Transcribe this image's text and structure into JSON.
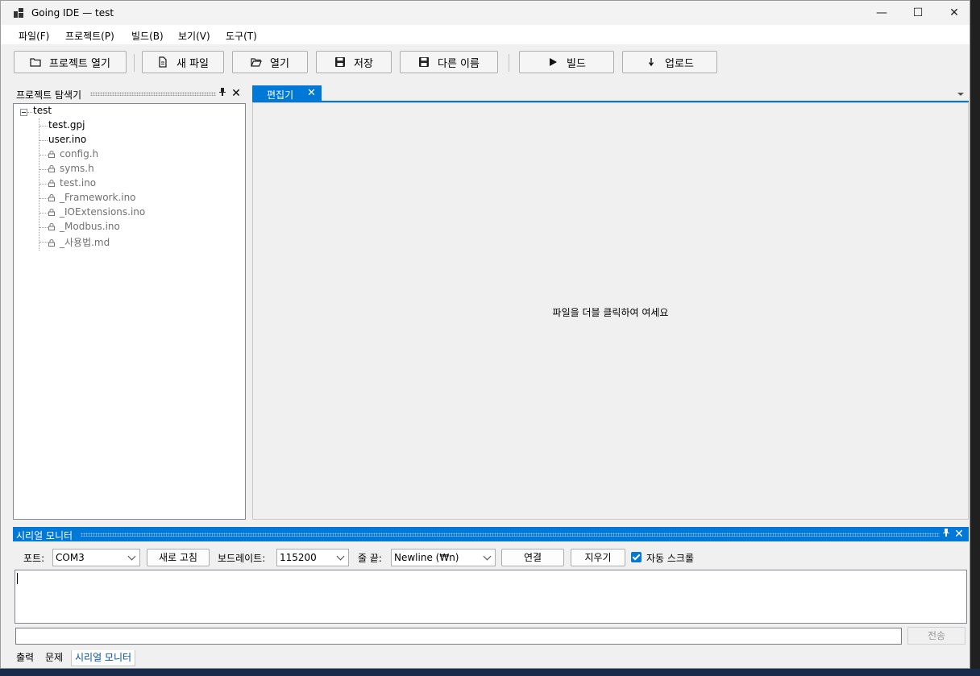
{
  "window": {
    "title": "Going IDE — test",
    "minimize_glyph": "—",
    "maximize_glyph": "☐",
    "close_glyph": "✕"
  },
  "menu": [
    "파일(F)",
    "프로젝트(P)",
    "빌드(B)",
    "보기(V)",
    "도구(T)"
  ],
  "toolbar": {
    "open_project": "프로젝트 열기",
    "new_file": "새 파일",
    "open": "열기",
    "save": "저장",
    "save_as": "다른 이름",
    "build": "빌드",
    "upload": "업로드"
  },
  "explorer": {
    "title": "프로젝트 탐색기",
    "root": "test",
    "files": [
      {
        "name": "test.gpj",
        "locked": false
      },
      {
        "name": "user.ino",
        "locked": false
      },
      {
        "name": "config.h",
        "locked": true
      },
      {
        "name": "syms.h",
        "locked": true
      },
      {
        "name": "test.ino",
        "locked": true
      },
      {
        "name": "_Framework.ino",
        "locked": true
      },
      {
        "name": "_IOExtensions.ino",
        "locked": true
      },
      {
        "name": "_Modbus.ino",
        "locked": true
      },
      {
        "name": "_사용법.md",
        "locked": true
      }
    ]
  },
  "editor": {
    "tab_label": "편집기",
    "placeholder": "파일을 더블 클릭하여 여세요"
  },
  "serial": {
    "title": "시리얼 모니터",
    "port_label": "포트:",
    "port_value": "COM3",
    "refresh": "새로 고침",
    "baud_label": "보드레이트:",
    "baud_value": "115200",
    "line_end_label": "줄 끝:",
    "line_end_value": "Newline (₩n)",
    "connect": "연결",
    "clear": "지우기",
    "autoscroll": "자동 스크롤",
    "autoscroll_checked": true,
    "send": "전송"
  },
  "bottom_tabs": [
    {
      "label": "출력",
      "active": false
    },
    {
      "label": "문제",
      "active": false
    },
    {
      "label": "시리얼 모니터",
      "active": true
    }
  ],
  "colors": {
    "accent": "#0078d7"
  }
}
